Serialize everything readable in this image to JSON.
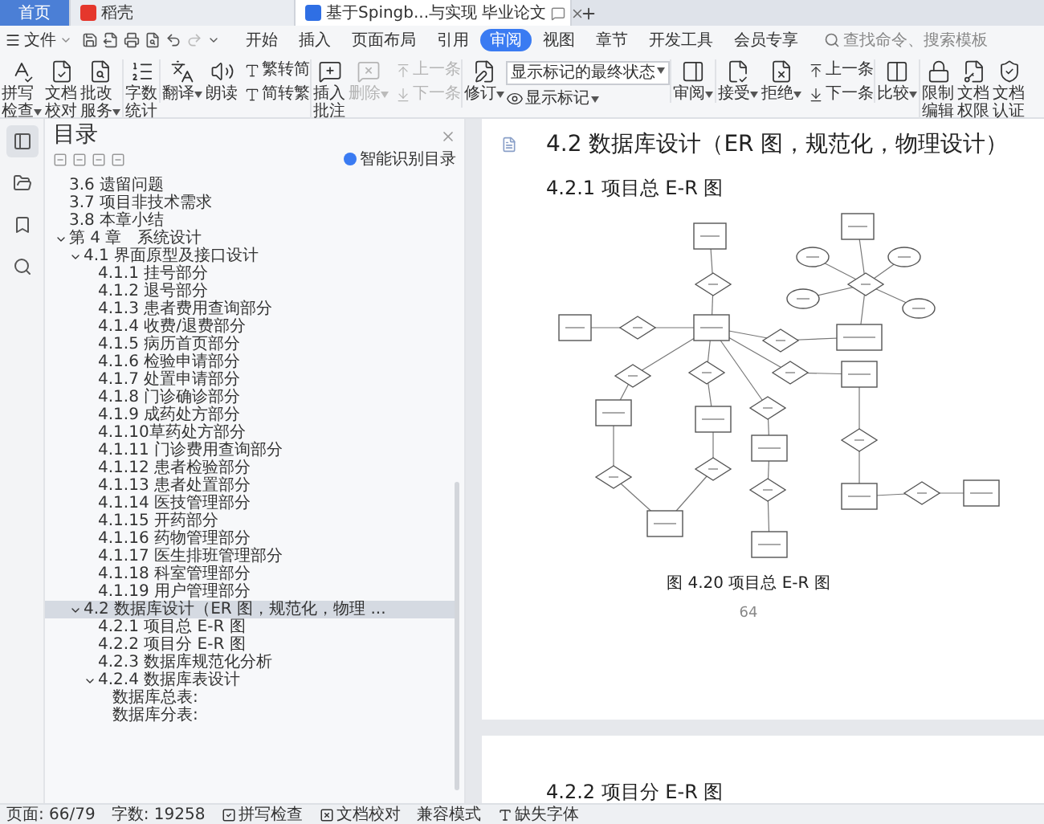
{
  "browser_tabs": [
    {
      "label": "首页",
      "kind": "home",
      "selected": false
    },
    {
      "label": "稻壳",
      "kind": "docer",
      "selected": false
    },
    {
      "label": "基于Spingb...与实现 毕业论文",
      "kind": "document",
      "selected": true
    }
  ],
  "menu": {
    "file_label": "文件",
    "tabs": [
      {
        "label": "开始",
        "selected": false
      },
      {
        "label": "插入",
        "selected": false
      },
      {
        "label": "页面布局",
        "selected": false
      },
      {
        "label": "引用",
        "selected": false
      },
      {
        "label": "审阅",
        "selected": true
      },
      {
        "label": "视图",
        "selected": false
      },
      {
        "label": "章节",
        "selected": false
      },
      {
        "label": "开发工具",
        "selected": false
      },
      {
        "label": "会员专享",
        "selected": false
      }
    ],
    "search_placeholder": "查找命令、搜索模板"
  },
  "ribbon": [
    [
      {
        "kind": "button",
        "label": "拼写检查",
        "dropdown": true,
        "disabled": false
      },
      {
        "kind": "button",
        "label": "文档校对",
        "dropdown": false,
        "disabled": false
      },
      {
        "kind": "button",
        "label": "批改服务",
        "dropdown": true,
        "disabled": false
      }
    ],
    [
      {
        "kind": "button",
        "label": "字数统计",
        "dropdown": false,
        "disabled": false
      }
    ],
    [
      {
        "kind": "button",
        "label": "翻译",
        "dropdown": true,
        "disabled": false
      },
      {
        "kind": "button",
        "label": "朗读",
        "dropdown": false,
        "disabled": false
      },
      {
        "kind": "pair",
        "items": [
          {
            "label": "繁转简",
            "disabled": false
          },
          {
            "label": "简转繁",
            "disabled": false
          }
        ]
      }
    ],
    [
      {
        "kind": "button",
        "label": "插入批注",
        "dropdown": false,
        "disabled": false
      },
      {
        "kind": "button",
        "label": "删除",
        "dropdown": true,
        "disabled": true
      },
      {
        "kind": "pair",
        "items": [
          {
            "label": "上一条",
            "disabled": true
          },
          {
            "label": "下一条",
            "disabled": true
          }
        ]
      }
    ],
    [
      {
        "kind": "button",
        "label": "修订",
        "dropdown": true,
        "disabled": false
      },
      {
        "kind": "select",
        "value": "显示标记的最终状态",
        "button_label": "显示标记"
      }
    ],
    [
      {
        "kind": "button",
        "label": "审阅",
        "dropdown": true,
        "disabled": false
      }
    ],
    [
      {
        "kind": "button",
        "label": "接受",
        "dropdown": true,
        "disabled": false
      },
      {
        "kind": "button",
        "label": "拒绝",
        "dropdown": true,
        "disabled": false
      },
      {
        "kind": "pair",
        "items": [
          {
            "label": "上一条",
            "disabled": false
          },
          {
            "label": "下一条",
            "disabled": false
          }
        ]
      }
    ],
    [
      {
        "kind": "button",
        "label": "比较",
        "dropdown": true,
        "disabled": false
      }
    ],
    [
      {
        "kind": "button",
        "label": "限制编辑",
        "dropdown": false,
        "disabled": false
      },
      {
        "kind": "button",
        "label": "文档权限",
        "dropdown": false,
        "disabled": false
      },
      {
        "kind": "button",
        "label": "文档认证",
        "dropdown": false,
        "disabled": false
      }
    ]
  ],
  "side_rail": [
    {
      "selected": true
    },
    {
      "selected": false
    },
    {
      "selected": false
    },
    {
      "selected": false
    }
  ],
  "outline": {
    "title": "目录",
    "smart_label": "智能识别目录",
    "items": [
      {
        "label": "3.6 遗留问题",
        "selected": false
      },
      {
        "label": "3.7 项目非技术需求",
        "selected": false
      },
      {
        "label": "3.8 本章小结",
        "selected": false
      },
      {
        "label": "第 4 章　系统设计",
        "selected": false,
        "expanded": true,
        "children": [
          {
            "label": "4.1 界面原型及接口设计",
            "selected": false,
            "expanded": true,
            "children": [
              {
                "label": "4.1.1 挂号部分",
                "selected": false
              },
              {
                "label": "4.1.2 退号部分",
                "selected": false
              },
              {
                "label": "4.1.3 患者费用查询部分",
                "selected": false
              },
              {
                "label": "4.1.4 收费/退费部分",
                "selected": false
              },
              {
                "label": "4.1.5 病历首页部分",
                "selected": false
              },
              {
                "label": "4.1.6 检验申请部分",
                "selected": false
              },
              {
                "label": "4.1.7 处置申请部分",
                "selected": false
              },
              {
                "label": "4.1.8 门诊确诊部分",
                "selected": false
              },
              {
                "label": "4.1.9 成药处方部分",
                "selected": false
              },
              {
                "label": "4.1.10草药处方部分",
                "selected": false
              },
              {
                "label": "4.1.11 门诊费用查询部分",
                "selected": false
              },
              {
                "label": "4.1.12 患者检验部分",
                "selected": false
              },
              {
                "label": "4.1.13 患者处置部分",
                "selected": false
              },
              {
                "label": "4.1.14 医技管理部分",
                "selected": false
              },
              {
                "label": "4.1.15 开药部分",
                "selected": false
              },
              {
                "label": "4.1.16 药物管理部分",
                "selected": false
              },
              {
                "label": "4.1.17 医生排班管理部分",
                "selected": false
              },
              {
                "label": "4.1.18 科室管理部分",
                "selected": false
              },
              {
                "label": "4.1.19 用户管理部分",
                "selected": false
              }
            ]
          },
          {
            "label": "4.2 数据库设计（ER 图，规范化，物理 ...",
            "selected": true,
            "expanded": true,
            "children": [
              {
                "label": "4.2.1 项目总 E-R 图",
                "selected": false
              },
              {
                "label": "4.2.2 项目分 E-R 图",
                "selected": false
              },
              {
                "label": "4.2.3 数据库规范化分析",
                "selected": false
              },
              {
                "label": "4.2.4 数据库表设计",
                "selected": false,
                "expanded": true,
                "children": [
                  {
                    "label": "数据库总表:",
                    "selected": false
                  },
                  {
                    "label": "数据库分表:",
                    "selected": false
                  }
                ]
              }
            ]
          }
        ]
      }
    ]
  },
  "document": {
    "heading": "4.2  数据库设计（ER 图，规范化，物理设计）",
    "subheading": "4.2.1 项目总 E-R 图",
    "caption": "图 4.20 项目总 E-R 图",
    "page_number": "64",
    "next_page_heading": "4.2.2 项目分 E-R 图"
  },
  "status_bar": [
    {
      "label": "页面: 66/79"
    },
    {
      "label": "字数: 19258"
    },
    {
      "label": "拼写检查"
    },
    {
      "label": "文档校对"
    },
    {
      "label": "兼容模式"
    },
    {
      "label": "缺失字体"
    }
  ]
}
